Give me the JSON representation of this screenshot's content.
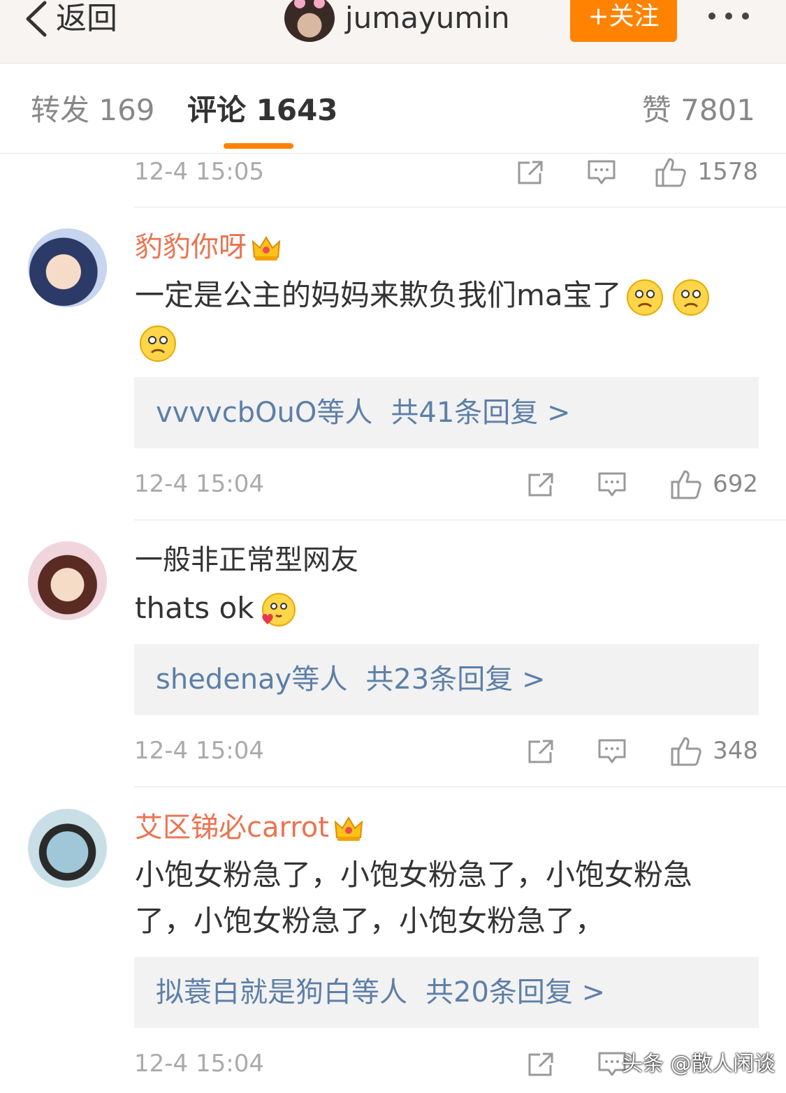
{
  "header": {
    "back_label": "返回",
    "username": "jumayumin",
    "follow_label": "+关注"
  },
  "tabs": {
    "repost": "转发 169",
    "comment": "评论 1643",
    "like": "赞 7801"
  },
  "comments": [
    {
      "timestamp": "12-4 15:05",
      "likes": "1578"
    },
    {
      "username": "豹豹你呀",
      "vip": true,
      "text": "一定是公主的妈妈来欺负我们ma宝了",
      "emojis": [
        "sad-emoji",
        "sad-emoji",
        "sad-emoji"
      ],
      "reply_users": "vvvvcbOuO等人",
      "reply_total": "共41条回复 >",
      "timestamp": "12-4 15:04",
      "likes": "692"
    },
    {
      "username": "一般非正常型网友",
      "vip": false,
      "text": "thats ok",
      "emojis": [
        "love-emoji"
      ],
      "reply_users": "shedenay等人",
      "reply_total": "共23条回复 >",
      "timestamp": "12-4 15:04",
      "likes": "348"
    },
    {
      "username": "艾区锑必carrot",
      "vip": true,
      "text": "小饱女粉急了，小饱女粉急了，小饱女粉急了，小饱女粉急了，小饱女粉急了，",
      "reply_users": "拟蓑白就是狗白等人",
      "reply_total": "共20条回复 >",
      "timestamp": "12-4 15:04"
    }
  ],
  "watermark": "头条 @散人闲谈",
  "colors": {
    "accent": "#ff8200",
    "vip_name": "#eb7350",
    "reply_link": "#5d7fa8"
  }
}
